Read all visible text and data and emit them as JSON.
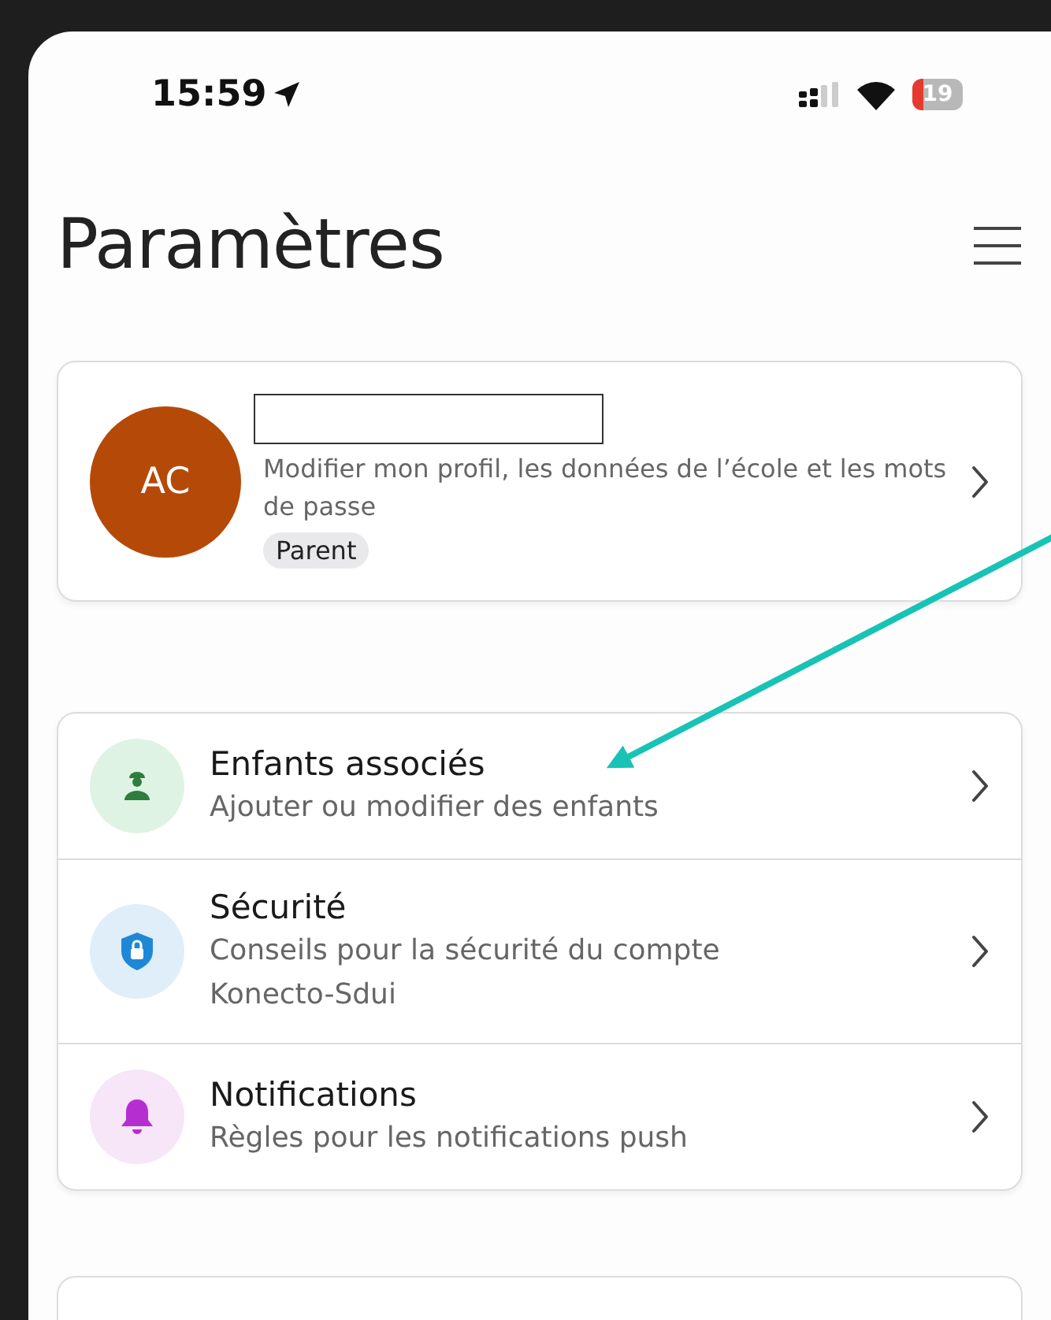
{
  "status_bar": {
    "time": "15:59",
    "battery": "19"
  },
  "title": "Paramètres",
  "profile": {
    "initials": "AC",
    "description": "Modifier mon profil, les données de l’école et les mots de passe",
    "role": "Parent"
  },
  "settings": [
    {
      "kind": "children",
      "title": "Enfants associés",
      "subtitle": "Ajouter ou modifier des enfants"
    },
    {
      "kind": "security",
      "title": "Sécurité",
      "subtitle": "Conseils pour la sécurité du compte Konecto-Sdui"
    },
    {
      "kind": "notifications",
      "title": "Notifications",
      "subtitle": "Règles pour les notifications push"
    }
  ]
}
